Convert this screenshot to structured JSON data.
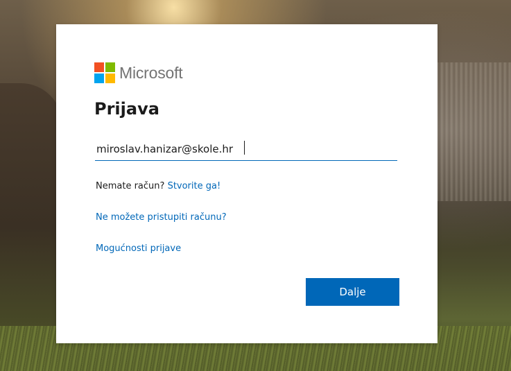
{
  "brand": {
    "name": "Microsoft",
    "logo_colors": [
      "#f25022",
      "#7fba00",
      "#00a4ef",
      "#ffb900"
    ]
  },
  "signin": {
    "title": "Prijava",
    "email_value": "miroslav.hanizar@skole.hr",
    "no_account_text": "Nemate račun?",
    "create_account_link": "Stvorite ga!",
    "cant_access_link": "Ne možete pristupiti računu?",
    "signin_options_link": "Mogućnosti prijave",
    "next_button_label": "Dalje"
  },
  "colors": {
    "accent": "#0067b8",
    "text": "#1b1b1b",
    "logo_text": "#737373",
    "card_background": "#ffffff"
  }
}
